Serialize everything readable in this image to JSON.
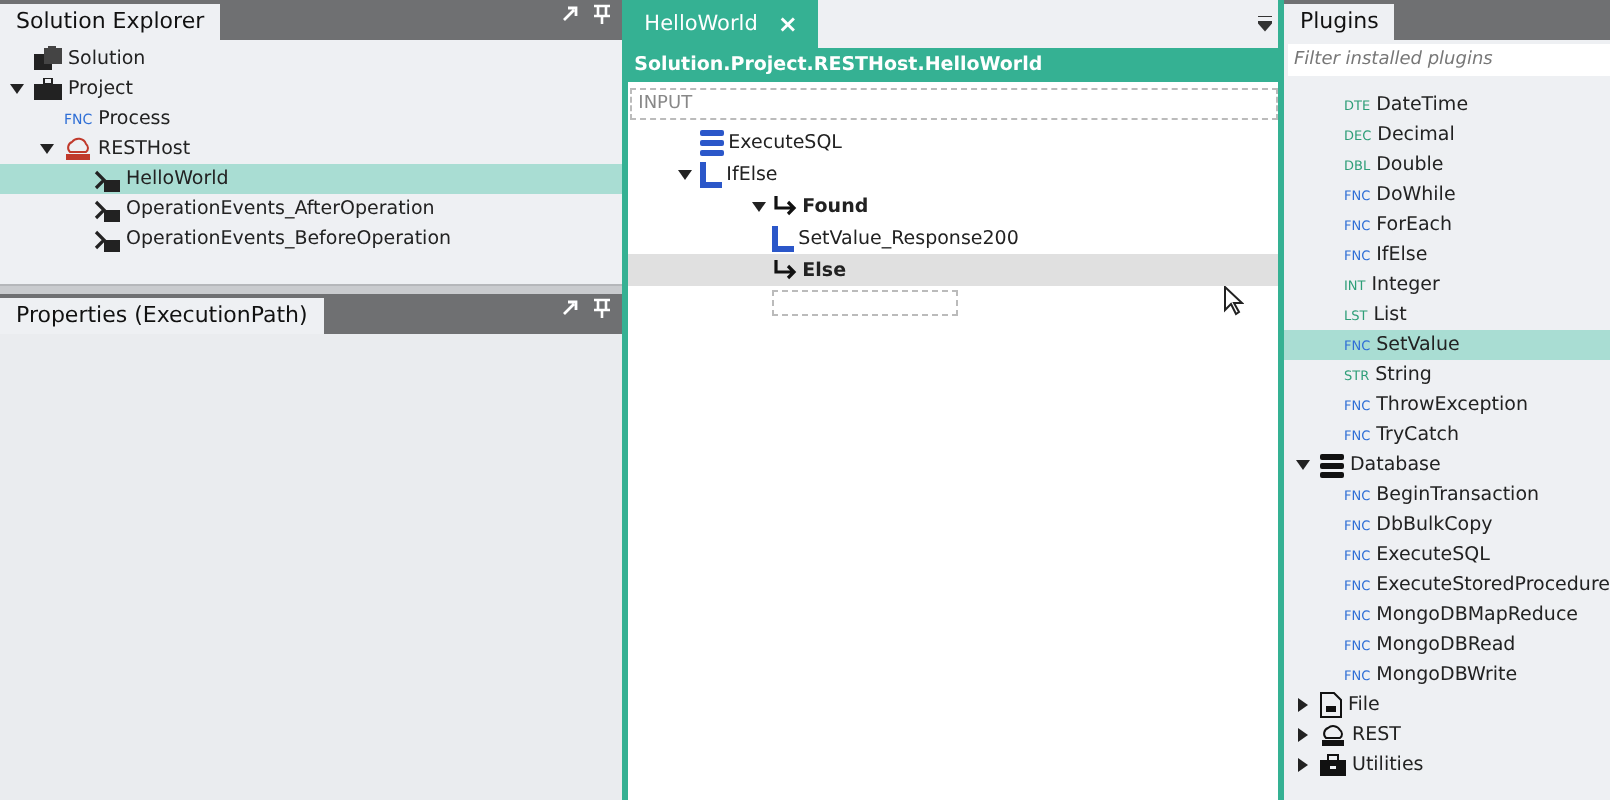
{
  "solution_explorer": {
    "title": "Solution Explorer",
    "tree": [
      {
        "label": "Solution",
        "kind": "solution",
        "selected": false
      },
      {
        "label": "Project",
        "kind": "project",
        "selected": false,
        "expanded": true,
        "children": [
          {
            "label": "Process",
            "kind": "function",
            "tag": "FNC",
            "selected": false
          },
          {
            "label": "RESTHost",
            "kind": "rest",
            "selected": false,
            "expanded": true,
            "children": [
              {
                "label": "HelloWorld",
                "kind": "operation",
                "selected": true
              },
              {
                "label": "OperationEvents_AfterOperation",
                "kind": "operation",
                "selected": false
              },
              {
                "label": "OperationEvents_BeforeOperation",
                "kind": "operation",
                "selected": false
              }
            ]
          }
        ]
      }
    ]
  },
  "properties": {
    "title": "Properties (ExecutionPath)"
  },
  "editor": {
    "tab": {
      "label": "HelloWorld",
      "close": "×"
    },
    "breadcrumb": "Solution.Project.RESTHost.HelloWorld",
    "input_label": "INPUT",
    "tree": [
      {
        "label": "ExecuteSQL",
        "kind": "database",
        "selected": false
      },
      {
        "label": "IfElse",
        "kind": "condition",
        "selected": false,
        "expanded": true,
        "children": [
          {
            "label": "Found",
            "kind": "branch",
            "selected": false,
            "expanded": true,
            "children": [
              {
                "label": "SetValue_Response200",
                "kind": "condition",
                "selected": false
              }
            ]
          },
          {
            "label": "Else",
            "kind": "branch",
            "selected": true,
            "children": [
              {
                "kind": "drop-slot"
              }
            ]
          }
        ]
      }
    ]
  },
  "plugins": {
    "title": "Plugins",
    "filter": {
      "placeholder": "Filter installed plugins"
    },
    "items": [
      {
        "tag": "DTE",
        "color": "#2e9e78",
        "label": "DateTime",
        "selected": false
      },
      {
        "tag": "DEC",
        "color": "#2e9e78",
        "label": "Decimal",
        "selected": false
      },
      {
        "tag": "DBL",
        "color": "#2e9e78",
        "label": "Double",
        "selected": false
      },
      {
        "tag": "FNC",
        "color": "#2f6fd6",
        "label": "DoWhile",
        "selected": false
      },
      {
        "tag": "FNC",
        "color": "#2f6fd6",
        "label": "ForEach",
        "selected": false
      },
      {
        "tag": "FNC",
        "color": "#2f6fd6",
        "label": "IfElse",
        "selected": false
      },
      {
        "tag": "INT",
        "color": "#2e9e78",
        "label": "Integer",
        "selected": false
      },
      {
        "tag": "LST",
        "color": "#2e9e78",
        "label": "List",
        "selected": false
      },
      {
        "tag": "FNC",
        "color": "#2f6fd6",
        "label": "SetValue",
        "selected": true
      },
      {
        "tag": "STR",
        "color": "#2e9e78",
        "label": "String",
        "selected": false
      },
      {
        "tag": "FNC",
        "color": "#2f6fd6",
        "label": "ThrowException",
        "selected": false
      },
      {
        "tag": "FNC",
        "color": "#2f6fd6",
        "label": "TryCatch",
        "selected": false
      }
    ],
    "groups": [
      {
        "label": "Database",
        "kind": "database",
        "expanded": true,
        "items": [
          {
            "tag": "FNC",
            "color": "#2f6fd6",
            "label": "BeginTransaction",
            "selected": false
          },
          {
            "tag": "FNC",
            "color": "#2f6fd6",
            "label": "DbBulkCopy",
            "selected": false
          },
          {
            "tag": "FNC",
            "color": "#2f6fd6",
            "label": "ExecuteSQL",
            "selected": false
          },
          {
            "tag": "FNC",
            "color": "#2f6fd6",
            "label": "ExecuteStoredProcedure",
            "selected": false
          },
          {
            "tag": "FNC",
            "color": "#2f6fd6",
            "label": "MongoDBMapReduce",
            "selected": false
          },
          {
            "tag": "FNC",
            "color": "#2f6fd6",
            "label": "MongoDBRead",
            "selected": false
          },
          {
            "tag": "FNC",
            "color": "#2f6fd6",
            "label": "MongoDBWrite",
            "selected": false
          }
        ]
      },
      {
        "label": "File",
        "kind": "file",
        "expanded": false
      },
      {
        "label": "REST",
        "kind": "rest",
        "expanded": false
      },
      {
        "label": "Utilities",
        "kind": "toolbox",
        "expanded": false
      }
    ]
  }
}
